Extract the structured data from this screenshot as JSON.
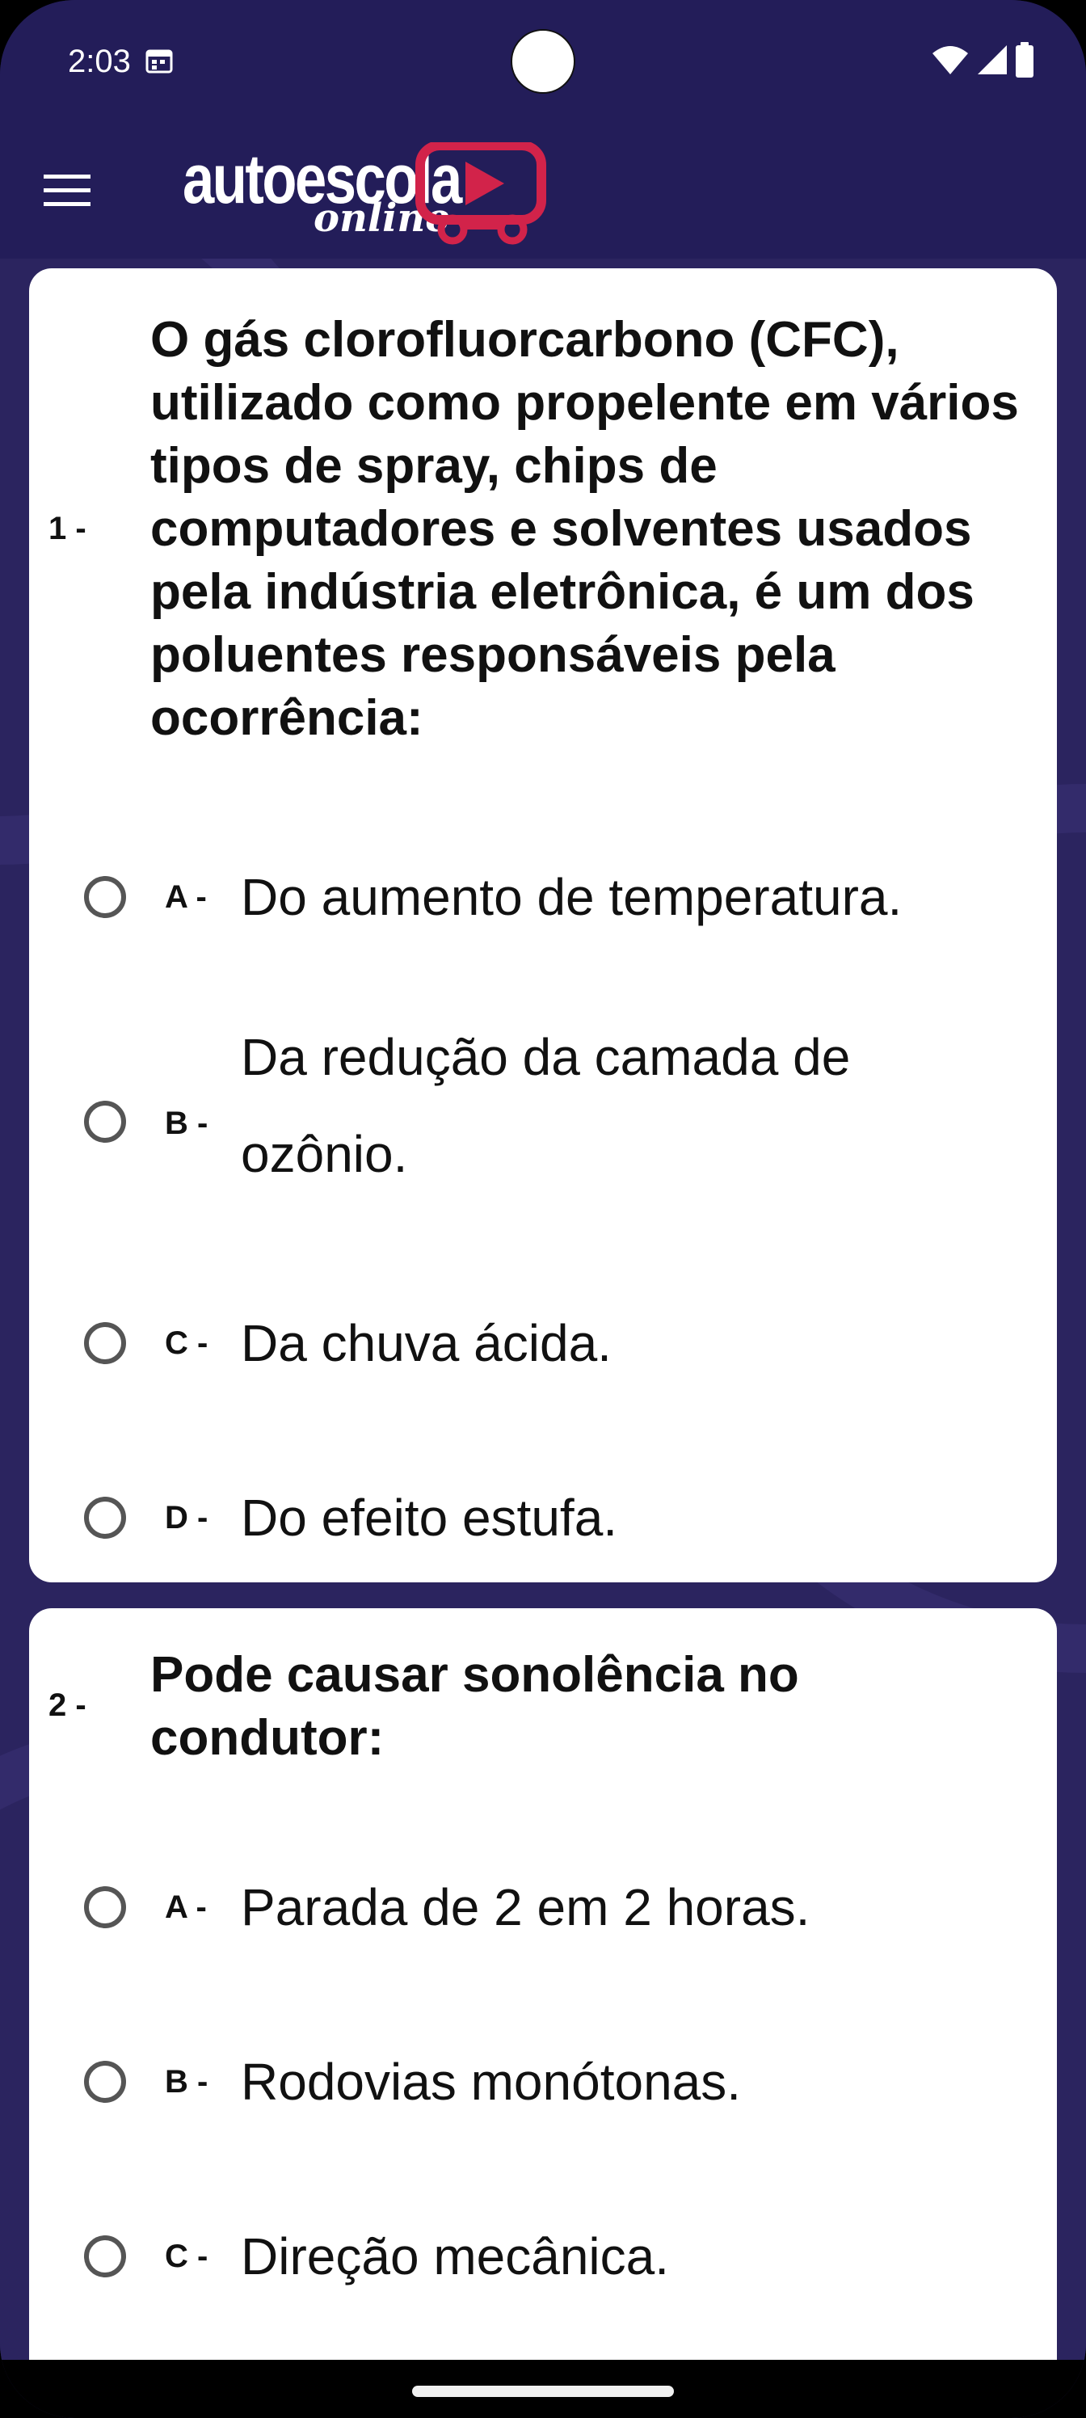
{
  "status_bar": {
    "time": "2:03",
    "icons": [
      "calendar-icon",
      "wifi-icon",
      "signal-icon",
      "battery-icon"
    ]
  },
  "app_bar": {
    "menu_icon": "hamburger-menu-icon",
    "logo": {
      "word": "autoescola",
      "sub": "online",
      "brand_color": "#d2234a"
    }
  },
  "colors": {
    "header_bg": "#231d59",
    "page_bg": "#2b245f",
    "card_bg": "#ffffff",
    "text": "#111111",
    "radio_border": "#555555"
  },
  "questions": [
    {
      "number": "1 -",
      "text": "O gás clorofluorcarbono (CFC), utilizado como propelente em vários tipos de spray, chips de computadores e solventes usados pela indústria eletrônica, é um dos poluentes responsáveis pela ocorrência:",
      "options": [
        {
          "letter": "A -",
          "text": "Do aumento de temperatura."
        },
        {
          "letter": "B -",
          "text": "Da redução da camada de ozônio."
        },
        {
          "letter": "C -",
          "text": "Da chuva ácida."
        },
        {
          "letter": "D -",
          "text": "Do efeito estufa."
        }
      ]
    },
    {
      "number": "2 -",
      "text": "Pode causar sonolência no condutor:",
      "options": [
        {
          "letter": "A -",
          "text": "Parada de 2 em 2 horas."
        },
        {
          "letter": "B -",
          "text": "Rodovias monótonas."
        },
        {
          "letter": "C -",
          "text": "Direção mecânica."
        }
      ]
    }
  ]
}
